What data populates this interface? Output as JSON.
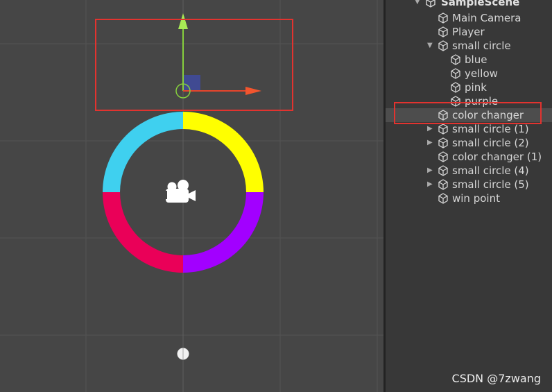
{
  "hierarchy": {
    "scene_name": "SampleScene",
    "items": [
      {
        "label": "Main Camera",
        "indent": 0,
        "arrow": "none"
      },
      {
        "label": "Player",
        "indent": 0,
        "arrow": "none"
      },
      {
        "label": "small circle",
        "indent": 0,
        "arrow": "expanded"
      },
      {
        "label": "blue",
        "indent": 1,
        "arrow": "none"
      },
      {
        "label": "yellow",
        "indent": 1,
        "arrow": "none"
      },
      {
        "label": "pink",
        "indent": 1,
        "arrow": "none"
      },
      {
        "label": "purple",
        "indent": 1,
        "arrow": "none"
      },
      {
        "label": "color changer",
        "indent": 0,
        "arrow": "none",
        "selected": true
      },
      {
        "label": "small circle (1)",
        "indent": 0,
        "arrow": "collapsed"
      },
      {
        "label": "small circle (2)",
        "indent": 0,
        "arrow": "collapsed"
      },
      {
        "label": "color changer (1)",
        "indent": 0,
        "arrow": "none"
      },
      {
        "label": "small circle (4)",
        "indent": 0,
        "arrow": "collapsed"
      },
      {
        "label": "small circle (5)",
        "indent": 0,
        "arrow": "collapsed"
      },
      {
        "label": "win point",
        "indent": 0,
        "arrow": "none"
      }
    ]
  },
  "scene": {
    "ring_colors": [
      "#ffff00",
      "#a200ff",
      "#ea0058",
      "#3fd0ef"
    ],
    "gizmo_colors": {
      "y_axis": "#86cf3d",
      "x_axis": "#e8452b",
      "plane": "#3f4a9a"
    },
    "camera_icon": "movie-camera-icon"
  },
  "watermark": "CSDN @7zwang"
}
